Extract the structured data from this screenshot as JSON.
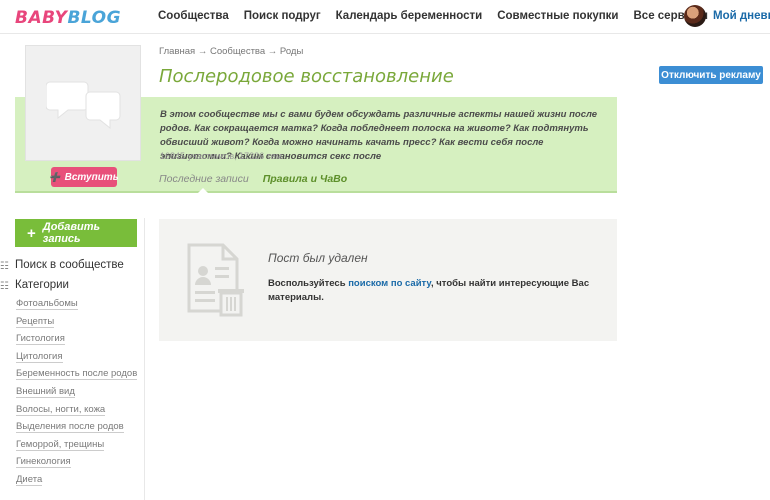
{
  "logo": {
    "part1": "BABY",
    "part2": "BLOG"
  },
  "nav": [
    "Сообщества",
    "Поиск подруг",
    "Календарь беременности",
    "Совместные покупки",
    "Все сервисы"
  ],
  "user": {
    "label": "Мой дневни"
  },
  "breadcrumb": {
    "home": "Главная",
    "communities": "Сообщества",
    "current": "Роды",
    "sep": "→"
  },
  "community": {
    "title": "Послеродовое восстановление",
    "description": "В этом сообществе мы с вами будем обсуждать различные аспекты нашей жизни после родов. Как сокращается матка? Когда побледнеет полоска на животе? Как подтянуть обвисший живот? Когда можно начинать качать пресс? Как вести себя после эпизиотомии? Каким становится секс после",
    "stats": "16845 участников, 17326 тем",
    "join_label": "Вступить"
  },
  "tabs": {
    "recent": "Последние записи",
    "rules": "Правила и ЧаВо"
  },
  "ads_button": "Отключить рекламу",
  "sidebar": {
    "add_post": "Добавить запись",
    "search": "Поиск в сообществе",
    "categories": "Категории",
    "category_items": [
      "Фотоальбомы",
      "Рецепты",
      "Гистология",
      "Цитология",
      "Беременность после родов",
      "Внешний вид",
      "Волосы, ногти, кожа",
      "Выделения после родов",
      "Геморрой, трещины",
      "Гинекология",
      "Диета"
    ]
  },
  "deleted_post": {
    "title": "Пост был удален",
    "text_before": "Воспользуйтесь ",
    "link": "поиском по сайту",
    "text_after": ", чтобы найти интересующие Вас материалы."
  },
  "colors": {
    "accent_green": "#79bd3a",
    "band_green": "#d6f0c0",
    "pink": "#e8507a",
    "blue": "#3c8ed4",
    "title_green": "#7aa83a"
  }
}
